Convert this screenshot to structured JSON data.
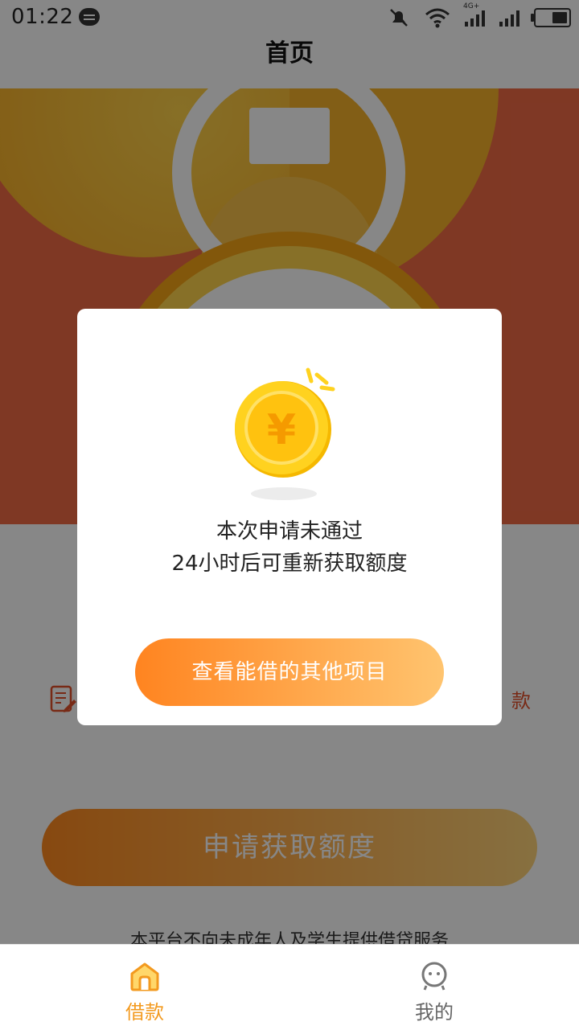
{
  "status_bar": {
    "time": "01:22",
    "icons": [
      "message-icon",
      "mute-icon",
      "wifi-icon",
      "4g-signal-icon",
      "signal-icon",
      "battery-icon"
    ],
    "network_label": "4G+"
  },
  "navbar": {
    "title": "首页"
  },
  "main": {
    "feature_right_label": "款",
    "apply_button_label": "申请获取额度",
    "notice": "本平台不向未成年人及学生提供借贷服务"
  },
  "modal": {
    "message_line1": "本次申请未通过",
    "message_line2": "24小时后可重新获取额度",
    "button_label": "查看能借的其他项目",
    "coin_symbol": "¥"
  },
  "tabbar": {
    "items": [
      {
        "label": "借款",
        "icon": "home-icon",
        "active": true
      },
      {
        "label": "我的",
        "icon": "profile-icon",
        "active": false
      }
    ]
  },
  "colors": {
    "accent_orange": "#f39a1f",
    "hero_red": "#f06a45",
    "gold": "#ffcf2e"
  }
}
